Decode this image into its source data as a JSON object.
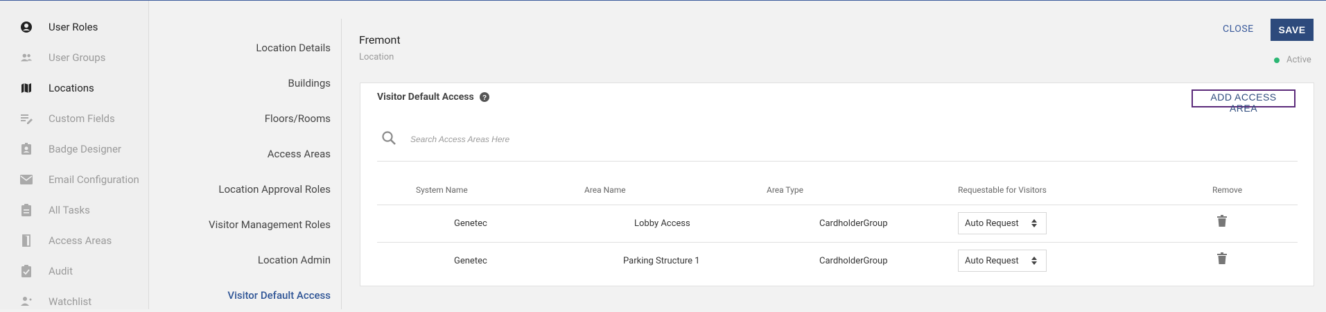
{
  "sidebar": {
    "items": [
      {
        "label": "User Roles",
        "icon": "account-circle-icon"
      },
      {
        "label": "User Groups",
        "icon": "users-icon"
      },
      {
        "label": "Locations",
        "icon": "map-icon"
      },
      {
        "label": "Custom Fields",
        "icon": "edit-list-icon"
      },
      {
        "label": "Badge Designer",
        "icon": "badge-icon"
      },
      {
        "label": "Email Configuration",
        "icon": "mail-icon"
      },
      {
        "label": "All Tasks",
        "icon": "clipboard-icon"
      },
      {
        "label": "Access Areas",
        "icon": "door-icon"
      },
      {
        "label": "Audit",
        "icon": "check-clipboard-icon"
      },
      {
        "label": "Watchlist",
        "icon": "person-watch-icon"
      }
    ]
  },
  "subnav": {
    "items": [
      "Location Details",
      "Buildings",
      "Floors/Rooms",
      "Access Areas",
      "Location Approval Roles",
      "Visitor Management Roles",
      "Location Admin",
      "Visitor Default Access"
    ],
    "active": "Visitor Default Access"
  },
  "header": {
    "title": "Fremont",
    "subtitle": "Location",
    "close_label": "CLOSE",
    "save_label": "SAVE",
    "status": "Active"
  },
  "card": {
    "title": "Visitor Default Access",
    "add_button": "ADD ACCESS AREA",
    "search_placeholder": "Search Access Areas Here",
    "columns": [
      "System Name",
      "Area Name",
      "Area Type",
      "Requestable for Visitors",
      "Remove"
    ],
    "rows": [
      {
        "system": "Genetec",
        "area": "Lobby Access",
        "type": "CardholderGroup",
        "requestable": "Auto Request"
      },
      {
        "system": "Genetec",
        "area": "Parking Structure 1",
        "type": "CardholderGroup",
        "requestable": "Auto Request"
      }
    ]
  },
  "colors": {
    "accent": "#2d4a7c",
    "link": "#2f5596",
    "status_active": "#2bb673",
    "add_border": "#5b2a7a"
  }
}
